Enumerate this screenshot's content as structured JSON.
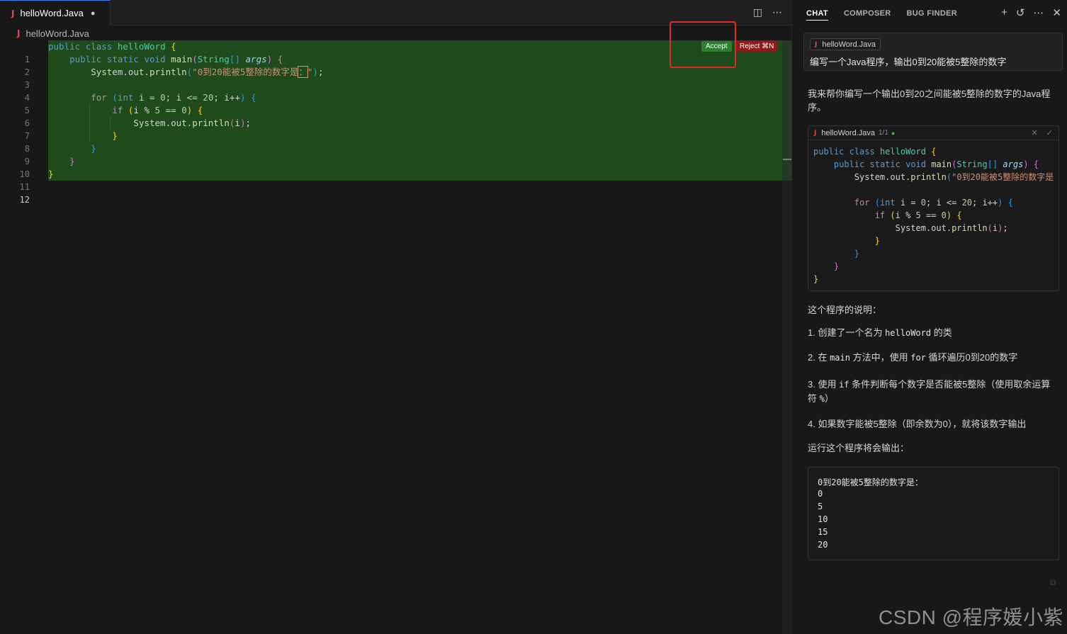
{
  "editor": {
    "tab_label": "helloWord.Java",
    "tab_modified_marker": "●",
    "breadcrumb": "helloWord.Java",
    "line_numbers": [
      "1",
      "2",
      "3",
      "4",
      "5",
      "6",
      "7",
      "8",
      "9",
      "10",
      "11",
      "12"
    ],
    "accept_label": "Accept",
    "reject_label": "Reject ⌘N",
    "split_icon": "split-editor-icon",
    "more_icon": "ellipsis-icon"
  },
  "chat": {
    "tabs": [
      "CHAT",
      "COMPOSER",
      "BUG FINDER"
    ],
    "active_tab": "CHAT",
    "user_message": {
      "context_chip": "helloWord.Java",
      "text": "编写一个Java程序，输出0到20能被5整除的数字"
    },
    "intro": "我来帮你编写一个输出0到20之间能被5整除的数字的Java程序。",
    "code_card": {
      "filename": "helloWord.Java",
      "counter": "1/1"
    },
    "explanation_title": "这个程序的说明：",
    "points": {
      "p1_pre": "1. 创建了一个名为 ",
      "p1_code": "helloWord",
      "p1_post": " 的类",
      "p2_pre": "2. 在 ",
      "p2_code": "main",
      "p2_mid": " 方法中，使用 ",
      "p2_code2": "for",
      "p2_post": " 循环遍历0到20的数字",
      "p3_pre": "3. 使用 ",
      "p3_code": "if",
      "p3_post": " 条件判断每个数字是否能被5整除（使用取余运算符 ",
      "p3_code2": "%",
      "p3_end": "）",
      "p4": "4. 如果数字能被5整除（即余数为0），就将该数字输出"
    },
    "run_title": "运行这个程序将会输出：",
    "output_lines": [
      "0到20能被5整除的数字是：",
      "0",
      "5",
      "10",
      "15",
      "20"
    ]
  },
  "watermark": "CSDN @程序媛小紫",
  "colors": {
    "added_line_bg": "#1e4a1c",
    "accept_bg": "#2f7d32",
    "reject_bg": "#8b1c1c",
    "highlight_box": "#e22b2b"
  }
}
